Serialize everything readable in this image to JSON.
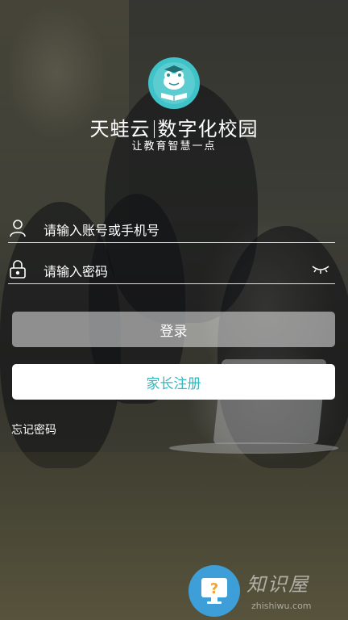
{
  "app": {
    "brand_name": "天蛙云",
    "product_name": "数字化校园",
    "slogan": "让教育智慧一点"
  },
  "form": {
    "account_placeholder": "请输入账号或手机号",
    "password_placeholder": "请输入密码",
    "login_label": "登录",
    "register_label": "家长注册",
    "forgot_label": "忘记密码"
  },
  "icons": {
    "logo": "frog-reading-book-icon",
    "account": "user-icon",
    "password": "lock-icon",
    "password_visibility": "eye-closed-icon",
    "watermark": "question-monitor-icon"
  },
  "watermark": {
    "text": "知识屋",
    "url": "zhishiwu.com"
  },
  "colors": {
    "accent": "#30b9c0",
    "logo_badge": "#3fc3c8",
    "watermark_badge": "#3e9ed8"
  }
}
